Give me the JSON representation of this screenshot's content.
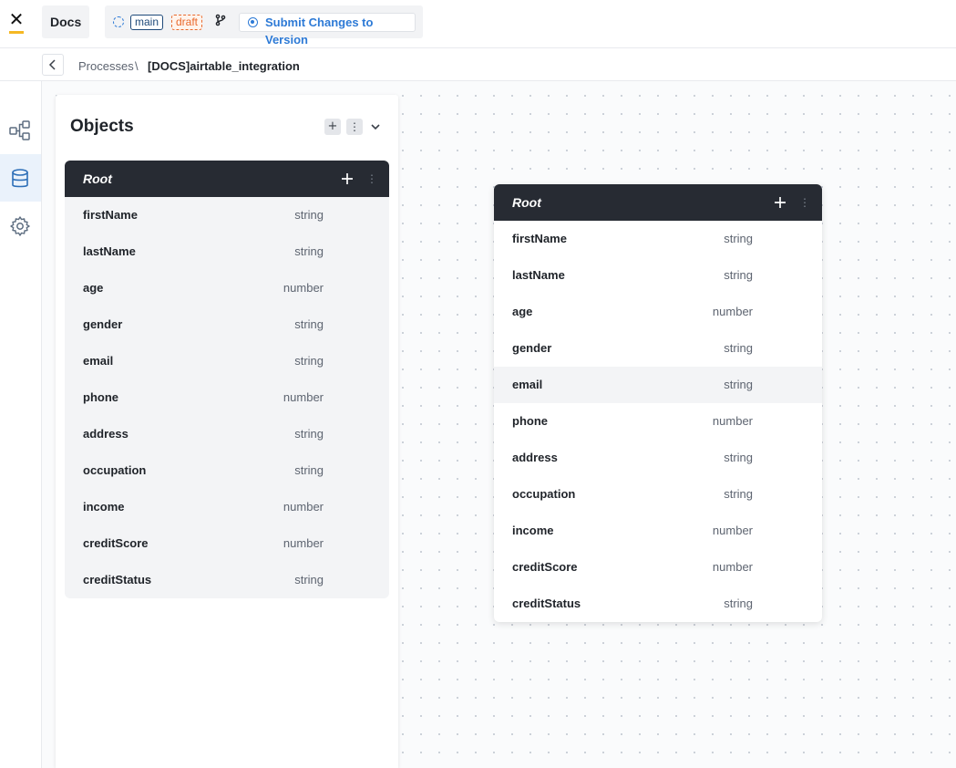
{
  "topbar": {
    "app_name": "Docs",
    "branch_tag": "main",
    "status_tag": "draft",
    "submit_label": "Submit Changes to Version",
    "accent_color": "#2d7ad6",
    "draft_color": "#e9692c"
  },
  "breadcrumb": {
    "items": [
      "Processes",
      "[DOCS]airtable_integration"
    ],
    "separator": "\\"
  },
  "sidebar": {
    "items": [
      {
        "icon": "process-diagram-icon",
        "active": false
      },
      {
        "icon": "database-icon",
        "active": true
      },
      {
        "icon": "gear-icon",
        "active": false
      }
    ]
  },
  "objects_panel": {
    "title": "Objects"
  },
  "root_object": {
    "title": "Root",
    "fields": [
      {
        "name": "firstName",
        "type": "string"
      },
      {
        "name": "lastName",
        "type": "string"
      },
      {
        "name": "age",
        "type": "number"
      },
      {
        "name": "gender",
        "type": "string"
      },
      {
        "name": "email",
        "type": "string"
      },
      {
        "name": "phone",
        "type": "number"
      },
      {
        "name": "address",
        "type": "string"
      },
      {
        "name": "occupation",
        "type": "string"
      },
      {
        "name": "income",
        "type": "number"
      },
      {
        "name": "creditScore",
        "type": "number"
      },
      {
        "name": "creditStatus",
        "type": "string"
      }
    ]
  },
  "canvas_card": {
    "title": "Root",
    "hovered_field": "email"
  }
}
